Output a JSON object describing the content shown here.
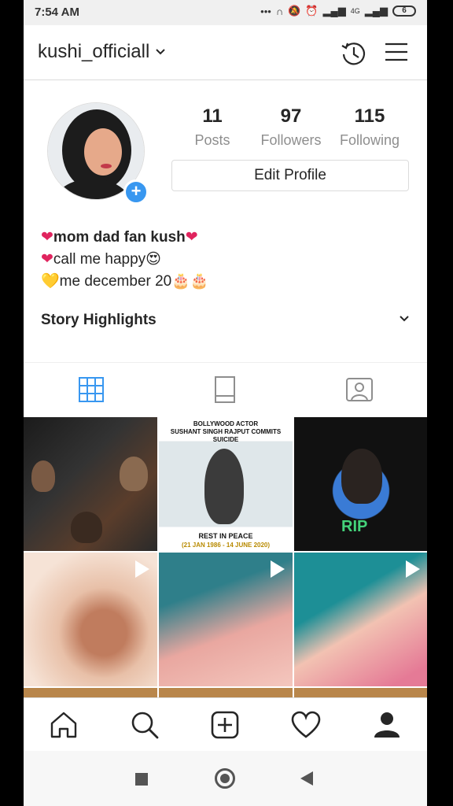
{
  "status_bar": {
    "time": "7:54 AM",
    "network": "4G",
    "battery": "6"
  },
  "header": {
    "username": "kushi_officiall",
    "chevron": "chevron-down-icon"
  },
  "profile": {
    "stats": [
      {
        "count": "11",
        "label": "Posts"
      },
      {
        "count": "97",
        "label": "Followers"
      },
      {
        "count": "115",
        "label": "Following"
      }
    ],
    "edit_profile_label": "Edit Profile",
    "bio": [
      {
        "emoji": "❤",
        "text": "mom dad fan kush",
        "emoji_end": "❤"
      },
      {
        "emoji": "❤",
        "text": "call me  happy",
        "emoji_end": "😍"
      },
      {
        "emoji": "💛",
        "text": "me december 20",
        "emoji_end": "🎂🎂"
      }
    ]
  },
  "story_highlights": {
    "label": "Story Highlights"
  },
  "posts": {
    "post2_top": "BOLLYWOOD ACTOR\nSUSHANT SINGH RAJPUT COMMITS SUICIDE",
    "post2_bottom": "REST IN PEACE",
    "post2_date": "(21 JAN 1986 - 14 JUNE 2020)",
    "post3_label": "RIP"
  },
  "colors": {
    "accent": "#3897f0",
    "text": "#262626",
    "muted": "#8e8e8e",
    "border": "#dbdbdb"
  }
}
